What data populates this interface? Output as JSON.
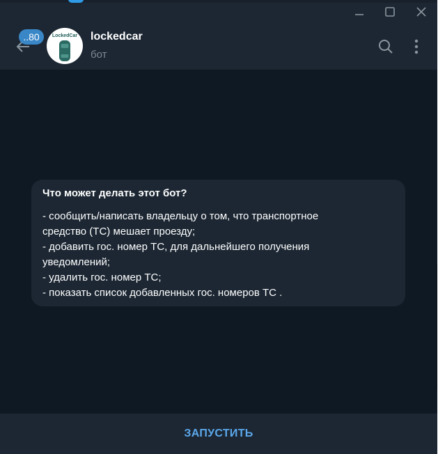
{
  "titlebar": {
    "controls": [
      {
        "name": "minimize",
        "icon": "minimize-icon"
      },
      {
        "name": "maximize",
        "icon": "maximize-icon"
      },
      {
        "name": "close",
        "icon": "close-icon"
      }
    ]
  },
  "header": {
    "back_icon": "arrow-left-icon",
    "unread_count": "..80",
    "avatar_logo_text": "LockedCar",
    "title": "lockedcar",
    "status": "бот",
    "search_icon": "search-icon",
    "menu_icon": "more-vertical-icon"
  },
  "bot_info": {
    "title": "Что может делать этот бот?",
    "lines": [
      "- сообщить/написать владельцу о том, что транспортное",
      "средство (ТС) мешает проезду;",
      "- добавить гос. номер ТС,  для дальнейшего получения",
      "уведомлений;",
      "- удалить гос. номер ТС;",
      "- показать список добавленных гос. номеров ТС ."
    ]
  },
  "bottom": {
    "start_label": "ЗАПУСТИТЬ"
  },
  "colors": {
    "background": "#0f1923",
    "panel": "#1c2733",
    "accent": "#5ca8ec",
    "badge": "#3a87c8",
    "muted_text": "#7b8791"
  }
}
